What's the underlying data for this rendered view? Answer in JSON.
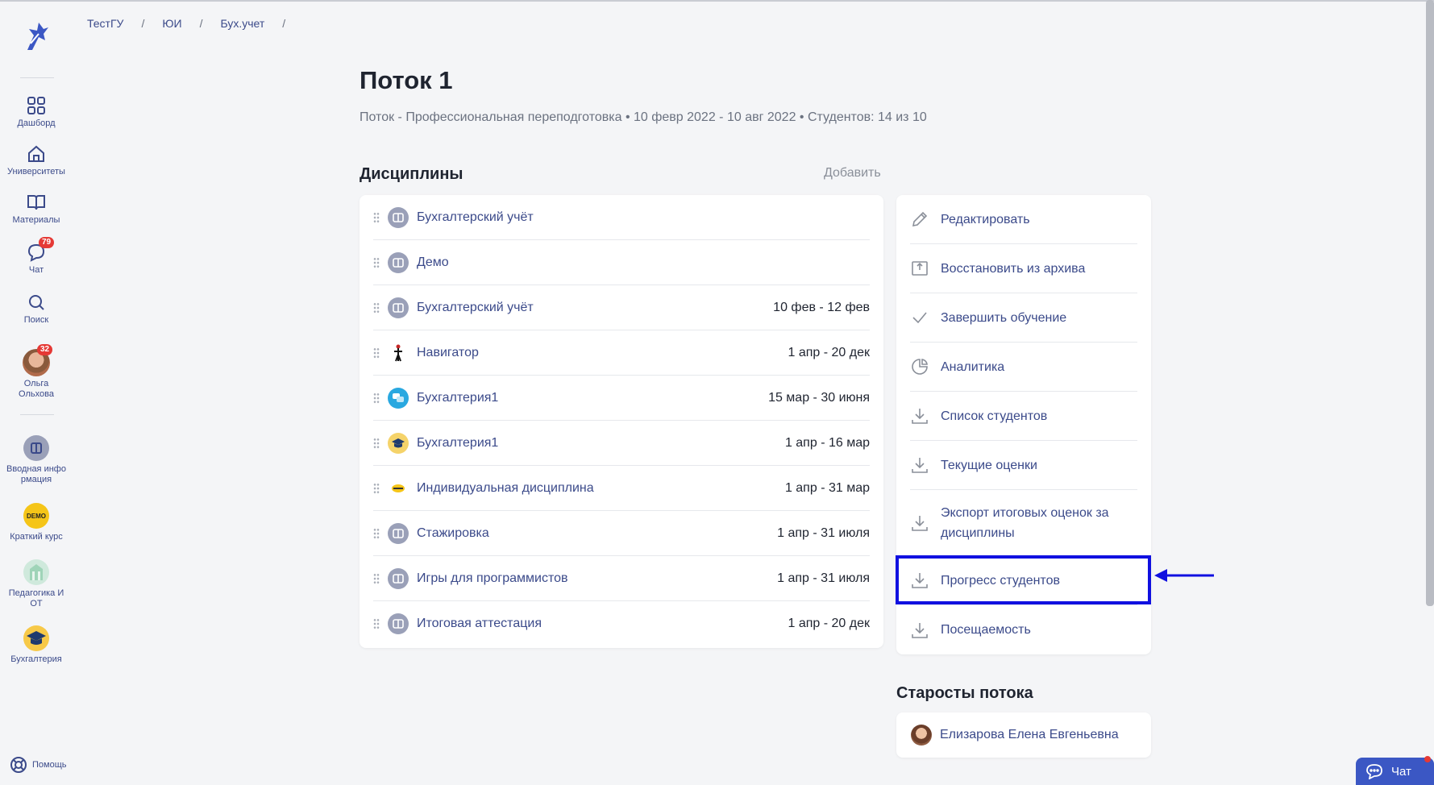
{
  "breadcrumb": [
    "ТестГУ",
    "ЮИ",
    "Бух.учет"
  ],
  "breadcrumb_separator": "/",
  "sidebar": {
    "nav": [
      {
        "label": "Дашборд",
        "icon": "grid-icon"
      },
      {
        "label": "Университеты",
        "icon": "home-icon"
      },
      {
        "label": "Материалы",
        "icon": "book-icon"
      },
      {
        "label": "Чат",
        "icon": "chat-icon",
        "badge": "79"
      },
      {
        "label": "Поиск",
        "icon": "search-icon"
      }
    ],
    "profile": {
      "name_line1": "Ольга",
      "name_line2": "Ольхова",
      "badge": "32"
    },
    "courses": [
      {
        "line1": "Вводная инфо",
        "line2": "рмация"
      },
      {
        "line1": "Краткий курс",
        "line2": ""
      },
      {
        "line1": "Педагогика И",
        "line2": "ОТ"
      },
      {
        "line1": "Бухгалтерия",
        "line2": ""
      }
    ],
    "demo_badge": "DEMO",
    "help_label": "Помощь"
  },
  "page": {
    "title": "Поток 1",
    "subtitle": "Поток - Профессиональная переподготовка • 10 февр 2022 - 10 авг 2022 • Студентов: 14 из 10"
  },
  "disciplines": {
    "heading": "Дисциплины",
    "add_label": "Добавить",
    "items": [
      {
        "name": "Бухгалтерский учёт",
        "dates": ""
      },
      {
        "name": "Демо",
        "dates": ""
      },
      {
        "name": "Бухгалтерский учёт",
        "dates": "10 фев - 12 фев"
      },
      {
        "name": "Навигатор",
        "dates": "1 апр - 20 дек"
      },
      {
        "name": "Бухгалтерия1",
        "dates": "15 мар - 30 июня"
      },
      {
        "name": "Бухгалтерия1",
        "dates": "1 апр - 16 мар"
      },
      {
        "name": "Индивидуальная дисциплина",
        "dates": "1 апр - 31 мар"
      },
      {
        "name": "Стажировка",
        "dates": "1 апр - 31 июля"
      },
      {
        "name": "Игры для программистов",
        "dates": "1 апр - 31 июля"
      },
      {
        "name": "Итоговая аттестация",
        "dates": "1 апр - 20 дек"
      }
    ]
  },
  "actions": [
    {
      "label": "Редактировать",
      "icon": "pencil-icon"
    },
    {
      "label": "Восстановить из архива",
      "icon": "archive-restore-icon"
    },
    {
      "label": "Завершить обучение",
      "icon": "check-icon"
    },
    {
      "label": "Аналитика",
      "icon": "pie-chart-icon"
    },
    {
      "label": "Список студентов",
      "icon": "download-icon"
    },
    {
      "label": "Текущие оценки",
      "icon": "download-icon"
    },
    {
      "label": "Экспорт итоговых оценок за дисциплины",
      "icon": "download-icon"
    },
    {
      "label": "Прогресс студентов",
      "icon": "download-icon",
      "highlighted": true
    },
    {
      "label": "Посещаемость",
      "icon": "download-icon"
    }
  ],
  "starosty": {
    "heading": "Старосты потока",
    "people": [
      "Елизарова Елена Евгеньевна"
    ]
  },
  "chat_button": {
    "label": "Чат"
  },
  "colors": {
    "link": "#3b4a8a",
    "highlight_border": "#1010e0",
    "badge": "#e53935",
    "chat_button": "#3b57c4"
  }
}
